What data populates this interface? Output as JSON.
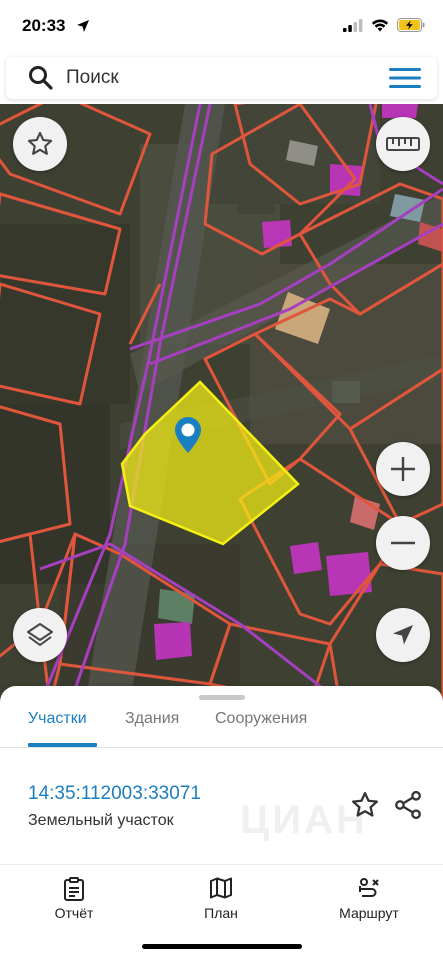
{
  "status_bar": {
    "time": "20:33"
  },
  "search": {
    "placeholder": "Поиск"
  },
  "sheet": {
    "tabs": [
      {
        "label": "Участки",
        "active": true
      },
      {
        "label": "Здания",
        "active": false
      },
      {
        "label": "Сооружения",
        "active": false
      }
    ],
    "parcel": {
      "cadastral_number": "14:35:112003:33071",
      "type": "Земельный участок"
    },
    "watermark": "ЦИАН"
  },
  "bottom_nav": [
    {
      "label": "Отчёт",
      "icon": "report-icon"
    },
    {
      "label": "План",
      "icon": "map-icon"
    },
    {
      "label": "Маршрут",
      "icon": "route-icon"
    }
  ],
  "colors": {
    "accent": "#1a7fc1",
    "parcel_fill": "#f5f013",
    "boundary_red": "#e0563c",
    "boundary_purple": "#a63fc0",
    "building_magenta": "#c534c4"
  }
}
